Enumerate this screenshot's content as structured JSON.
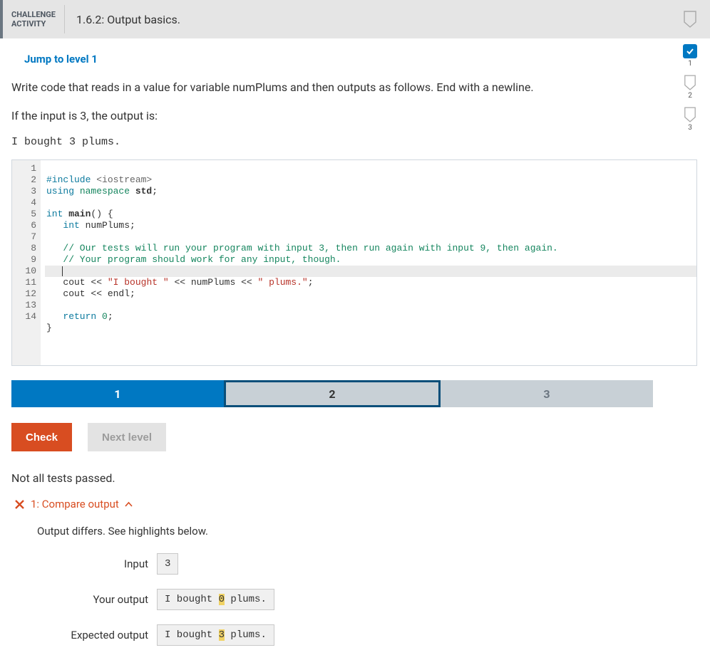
{
  "header": {
    "label_line1": "CHALLENGE",
    "label_line2": "ACTIVITY",
    "title_num": "1.6.2:",
    "title_text": "Output basics."
  },
  "rail": {
    "items": [
      {
        "state": "done",
        "num": "1"
      },
      {
        "state": "pending",
        "num": "2"
      },
      {
        "state": "pending",
        "num": "3"
      }
    ]
  },
  "jump_label": "Jump to level 1",
  "prompt_line1": "Write code that reads in a value for variable numPlums and then outputs as follows. End with a newline.",
  "prompt_line2": "If the input is 3, the output is:",
  "prompt_sample": "I bought 3 plums.",
  "code": {
    "lines": [
      {
        "n": "1"
      },
      {
        "n": "2"
      },
      {
        "n": "3"
      },
      {
        "n": "4"
      },
      {
        "n": "5"
      },
      {
        "n": "6"
      },
      {
        "n": "7"
      },
      {
        "n": "8"
      },
      {
        "n": "9"
      },
      {
        "n": "10"
      },
      {
        "n": "11"
      },
      {
        "n": "12"
      },
      {
        "n": "13"
      },
      {
        "n": "14"
      }
    ],
    "l1_pp": "#include",
    "l1_inc": " <iostream>",
    "l2_kw": "using",
    "l2_ns": " namespace",
    "l2_id": " std",
    "l2_end": ";",
    "l4_type": "int",
    "l4_id": " main",
    "l4_rest": "() {",
    "l5_indent": "   ",
    "l5_type": "int",
    "l5_id": " numPlums",
    "l5_end": ";",
    "l7_indent": "   ",
    "l7_cmt": "// Our tests will run your program with input 3, then run again with input 9, then again.",
    "l8_indent": "   ",
    "l8_cmt": "// Your program should work for any input, though.",
    "l9_indent": "   ",
    "l10_indent": "   ",
    "l10_a": "cout ",
    "l10_b": "<<",
    "l10_str1": " \"I bought \"",
    "l10_c": " << ",
    "l10_id": "numPlums",
    "l10_d": " <<",
    "l10_str2": " \" plums.\"",
    "l10_end": ";",
    "l11_indent": "   ",
    "l11_a": "cout ",
    "l11_b": "<<",
    "l11_c": " endl;",
    "l13_indent": "   ",
    "l13_kw": "return",
    "l13_num": " 0",
    "l13_end": ";",
    "l14": "}"
  },
  "steps": {
    "s1": "1",
    "s2": "2",
    "s3": "3"
  },
  "buttons": {
    "check": "Check",
    "next": "Next level"
  },
  "feedback": {
    "title": "Not all tests passed.",
    "test_label": "1: Compare output",
    "msg": "Output differs. See highlights below.",
    "rows": {
      "input_label": "Input",
      "input_val": "3",
      "your_label": "Your output",
      "your_prefix": "I bought ",
      "your_hl": "0",
      "your_suffix": " plums.",
      "exp_label": "Expected output",
      "exp_prefix": "I bought ",
      "exp_hl": "3",
      "exp_suffix": " plums."
    }
  }
}
